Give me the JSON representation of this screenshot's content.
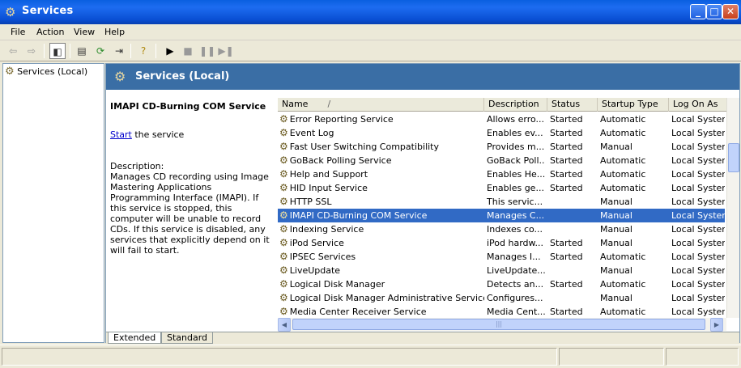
{
  "window": {
    "title": "Services"
  },
  "menu": [
    "File",
    "Action",
    "View",
    "Help"
  ],
  "tree": {
    "root": "Services (Local)"
  },
  "banner": {
    "title": "Services (Local)"
  },
  "description_pane": {
    "service_name": "IMAPI CD-Burning COM Service",
    "start_link": "Start",
    "start_suffix": " the service",
    "desc_label": "Description:",
    "desc_text": "Manages CD recording using Image Mastering Applications Programming Interface (IMAPI). If this service is stopped, this computer will be unable to record CDs. If this service is disabled, any services that explicitly depend on it will fail to start."
  },
  "columns": [
    "Name",
    "Description",
    "Status",
    "Startup Type",
    "Log On As"
  ],
  "sort_indicator": "/",
  "services": [
    {
      "name": "Error Reporting Service",
      "desc": "Allows erro...",
      "status": "Started",
      "startup": "Automatic",
      "logon": "Local System"
    },
    {
      "name": "Event Log",
      "desc": "Enables ev...",
      "status": "Started",
      "startup": "Automatic",
      "logon": "Local System"
    },
    {
      "name": "Fast User Switching Compatibility",
      "desc": "Provides m...",
      "status": "Started",
      "startup": "Manual",
      "logon": "Local System"
    },
    {
      "name": "GoBack Polling Service",
      "desc": "GoBack Poll...",
      "status": "Started",
      "startup": "Automatic",
      "logon": "Local System"
    },
    {
      "name": "Help and Support",
      "desc": "Enables He...",
      "status": "Started",
      "startup": "Automatic",
      "logon": "Local System"
    },
    {
      "name": "HID Input Service",
      "desc": "Enables ge...",
      "status": "Started",
      "startup": "Automatic",
      "logon": "Local System"
    },
    {
      "name": "HTTP SSL",
      "desc": "This servic...",
      "status": "",
      "startup": "Manual",
      "logon": "Local System"
    },
    {
      "name": "IMAPI CD-Burning COM Service",
      "desc": "Manages C...",
      "status": "",
      "startup": "Manual",
      "logon": "Local System",
      "selected": true
    },
    {
      "name": "Indexing Service",
      "desc": "Indexes co...",
      "status": "",
      "startup": "Manual",
      "logon": "Local System"
    },
    {
      "name": "iPod Service",
      "desc": "iPod hardw...",
      "status": "Started",
      "startup": "Manual",
      "logon": "Local System"
    },
    {
      "name": "IPSEC Services",
      "desc": "Manages I...",
      "status": "Started",
      "startup": "Automatic",
      "logon": "Local System"
    },
    {
      "name": "LiveUpdate",
      "desc": "LiveUpdate...",
      "status": "",
      "startup": "Manual",
      "logon": "Local System"
    },
    {
      "name": "Logical Disk Manager",
      "desc": "Detects an...",
      "status": "Started",
      "startup": "Automatic",
      "logon": "Local System"
    },
    {
      "name": "Logical Disk Manager Administrative Service",
      "desc": "Configures...",
      "status": "",
      "startup": "Manual",
      "logon": "Local System"
    },
    {
      "name": "Media Center Receiver Service",
      "desc": "Media Cent...",
      "status": "Started",
      "startup": "Automatic",
      "logon": "Local System"
    }
  ],
  "tabs": [
    "Extended",
    "Standard"
  ],
  "active_tab": "Extended",
  "colors": {
    "title_bar": "#0a5fe0",
    "banner": "#3a6ea5",
    "selection": "#316ac5",
    "link": "#0000cc"
  },
  "icons": [
    "gear-icon",
    "back-icon",
    "forward-icon",
    "show-hide-tree-icon",
    "properties-icon",
    "refresh-icon",
    "export-list-icon",
    "help-icon",
    "play-icon",
    "stop-icon",
    "pause-icon",
    "restart-icon"
  ]
}
